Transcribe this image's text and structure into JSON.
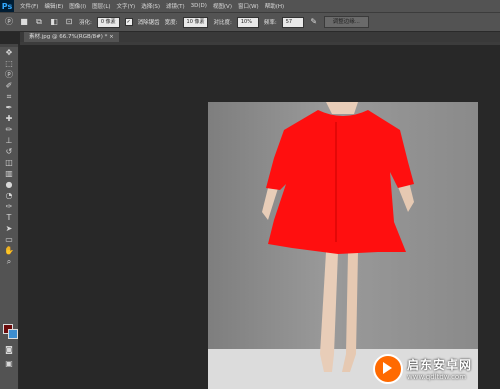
{
  "app": {
    "logo": "Ps"
  },
  "menu": [
    "文件(F)",
    "编辑(E)",
    "图像(I)",
    "图层(L)",
    "文字(Y)",
    "选择(S)",
    "滤镜(T)",
    "3D(D)",
    "视图(V)",
    "窗口(W)",
    "帮助(H)"
  ],
  "options": {
    "feather_label": "羽化:",
    "feather_value": "0 像素",
    "antialias_label": "消除锯齿",
    "antialias_checked": "✓",
    "width_label": "宽度:",
    "width_value": "10 像素",
    "contrast_label": "对比度:",
    "contrast_value": "10%",
    "frequency_label": "频率:",
    "frequency_value": "57",
    "refine_edge": "调整边缘..."
  },
  "document": {
    "tab_label": "素材.jpg @ 66.7%(RGB/8#) * ×"
  },
  "colors": {
    "foreground": "#6b0b0b",
    "background": "#3d8ed0",
    "dress": "#ff0f0f"
  },
  "watermark": {
    "title": "启东安卓网",
    "url": "www.qdltdw.com"
  }
}
